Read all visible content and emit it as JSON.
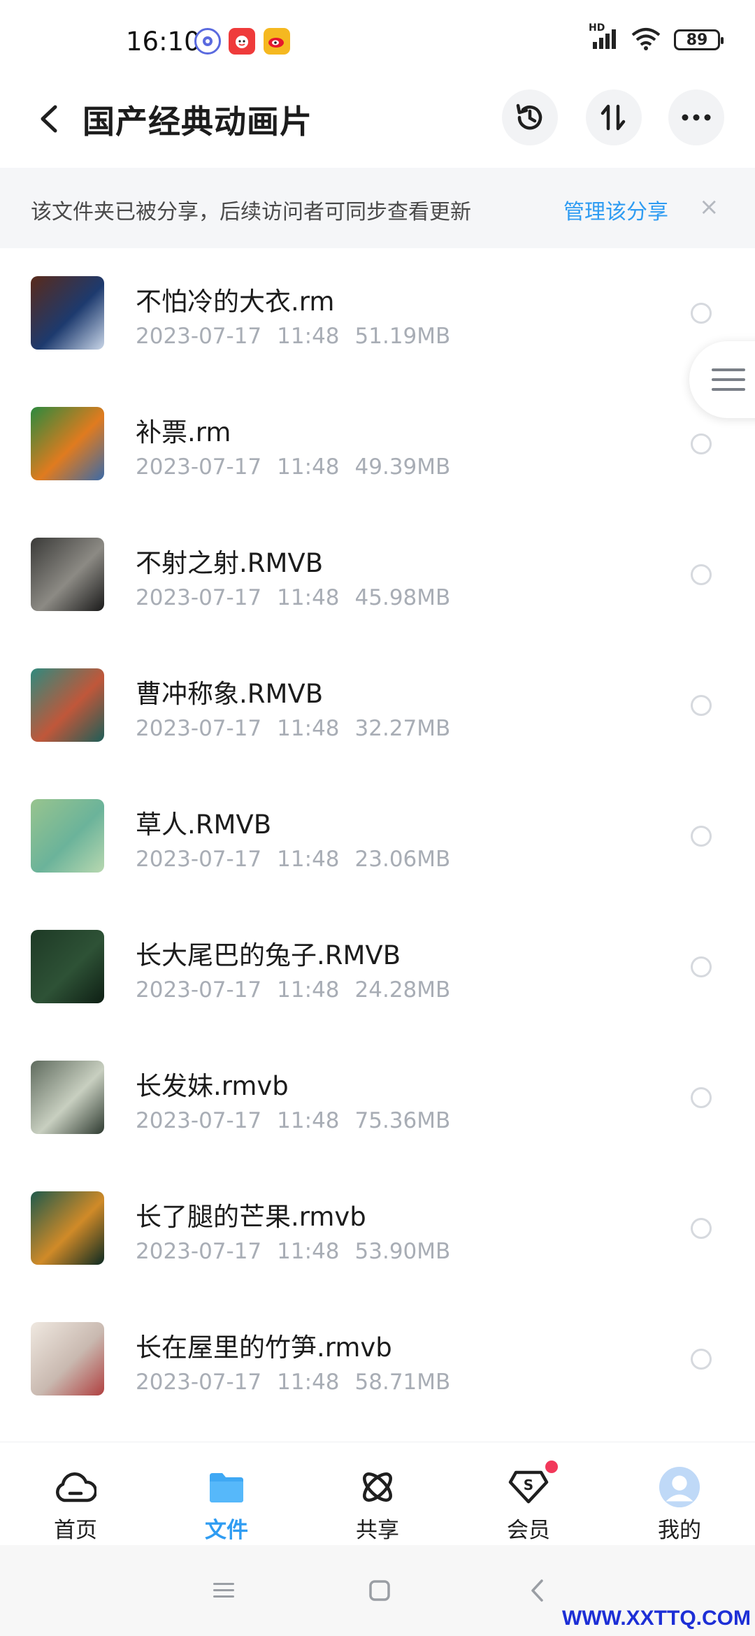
{
  "status_bar": {
    "time": "16:10",
    "network_label": "HD",
    "battery": "89"
  },
  "header": {
    "title": "国产经典动画片",
    "icons": [
      "back-icon",
      "history-icon",
      "sort-icon",
      "more-icon"
    ]
  },
  "banner": {
    "text": "该文件夹已被分享，后续访问者可同步查看更新",
    "link": "管理该分享",
    "close": "×",
    "link_color": "#2f9cf2"
  },
  "files": [
    {
      "name": "不怕冷的大衣.rm",
      "date": "2023-07-17",
      "time": "11:48",
      "size": "51.19MB",
      "thumb_colors": [
        "#5a2a1a",
        "#1d3a6e",
        "#c9d6e8"
      ]
    },
    {
      "name": "补票.rm",
      "date": "2023-07-17",
      "time": "11:48",
      "size": "49.39MB",
      "thumb_colors": [
        "#2b8a3e",
        "#e07b1f",
        "#3a6aa8"
      ]
    },
    {
      "name": "不射之射.RMVB",
      "date": "2023-07-17",
      "time": "11:48",
      "size": "45.98MB",
      "thumb_colors": [
        "#3a3a38",
        "#8c8a84",
        "#1a1a1a"
      ]
    },
    {
      "name": "曹冲称象.RMVB",
      "date": "2023-07-17",
      "time": "11:48",
      "size": "32.27MB",
      "thumb_colors": [
        "#2f8a7e",
        "#c0573a",
        "#1d5e58"
      ]
    },
    {
      "name": "草人.RMVB",
      "date": "2023-07-17",
      "time": "11:48",
      "size": "23.06MB",
      "thumb_colors": [
        "#98c48e",
        "#6bb39a",
        "#b8d8b0"
      ]
    },
    {
      "name": "长大尾巴的兔子.RMVB",
      "date": "2023-07-17",
      "time": "11:48",
      "size": "24.28MB",
      "thumb_colors": [
        "#1e3a26",
        "#2e5236",
        "#0e1f14"
      ]
    },
    {
      "name": "长发妹.rmvb",
      "date": "2023-07-17",
      "time": "11:48",
      "size": "75.36MB",
      "thumb_colors": [
        "#5f6b5e",
        "#c8cfc0",
        "#2e3a30"
      ]
    },
    {
      "name": "长了腿的芒果.rmvb",
      "date": "2023-07-17",
      "time": "11:48",
      "size": "53.90MB",
      "thumb_colors": [
        "#1f5a4c",
        "#d08a28",
        "#0c2a22"
      ]
    },
    {
      "name": "长在屋里的竹笋.rmvb",
      "date": "2023-07-17",
      "time": "11:48",
      "size": "58.71MB",
      "thumb_colors": [
        "#efe8e0",
        "#c9b9b0",
        "#b04040"
      ]
    }
  ],
  "tabs": [
    {
      "label": "首页",
      "icon": "home-cloud-icon",
      "active": false
    },
    {
      "label": "文件",
      "icon": "folder-icon",
      "active": true
    },
    {
      "label": "共享",
      "icon": "share-orbit-icon",
      "active": false
    },
    {
      "label": "会员",
      "icon": "vip-icon",
      "active": false,
      "badge": true
    },
    {
      "label": "我的",
      "icon": "avatar-icon",
      "active": false
    }
  ],
  "watermark": "WWW.XXTTQ.COM",
  "accent_color": "#2f9cf2"
}
